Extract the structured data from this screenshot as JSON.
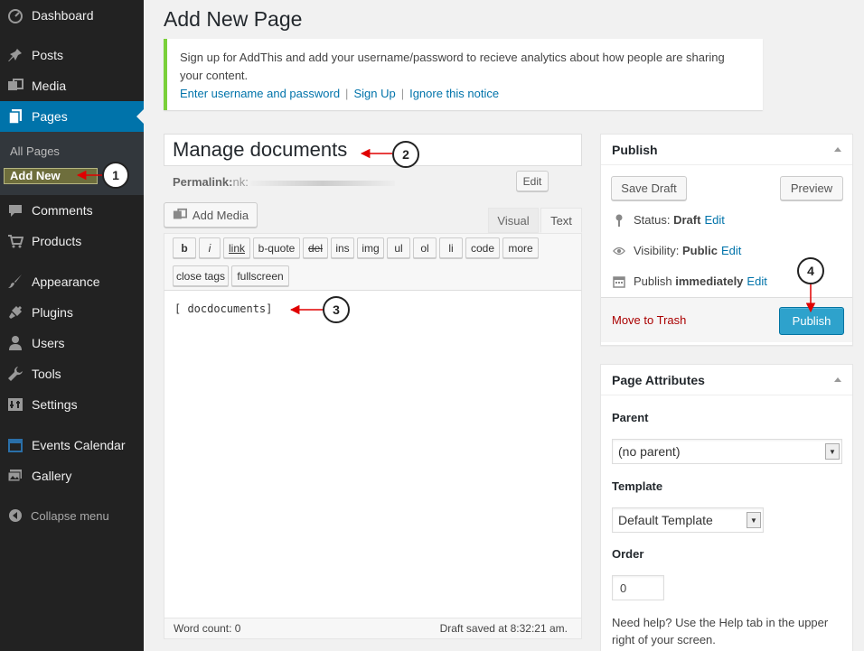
{
  "sidebar": {
    "items": [
      {
        "label": "Dashboard",
        "icon": "dashboard-icon"
      },
      {
        "label": "Posts",
        "icon": "pin-icon"
      },
      {
        "label": "Media",
        "icon": "media-icon"
      },
      {
        "label": "Pages",
        "icon": "pages-icon"
      },
      {
        "label": "Comments",
        "icon": "comment-icon"
      },
      {
        "label": "Products",
        "icon": "cart-icon"
      },
      {
        "label": "Appearance",
        "icon": "brush-icon"
      },
      {
        "label": "Plugins",
        "icon": "plugin-icon"
      },
      {
        "label": "Users",
        "icon": "user-icon"
      },
      {
        "label": "Tools",
        "icon": "wrench-icon"
      },
      {
        "label": "Settings",
        "icon": "settings-icon"
      },
      {
        "label": "Events Calendar",
        "icon": "calendar-icon"
      },
      {
        "label": "Gallery",
        "icon": "gallery-icon"
      }
    ],
    "submenu": {
      "all_pages": "All Pages",
      "add_new": "Add New"
    },
    "collapse": "Collapse menu"
  },
  "page": {
    "title": "Add New Page"
  },
  "notice": {
    "text": "Sign up for AddThis and add your username/password to recieve analytics about how people are sharing your content.",
    "link1": "Enter username and password",
    "link2": "Sign Up",
    "link3": "Ignore this notice",
    "sep": "|"
  },
  "editor": {
    "title_value": "Manage documents",
    "permalink_label": "Permalink:",
    "permalink_value": "nk:",
    "edit_label": "Edit",
    "add_media": "Add Media",
    "tab_visual": "Visual",
    "tab_text": "Text",
    "quicktags_row1": [
      "b",
      "i",
      "link",
      "b-quote",
      "del",
      "ins",
      "img",
      "ul",
      "ol",
      "li",
      "code",
      "more"
    ],
    "quicktags_row2": [
      "close tags",
      "fullscreen"
    ],
    "content": "[    docdocuments]",
    "word_count": "Word count: 0",
    "draft_saved": "Draft saved at 8:32:21 am."
  },
  "publish": {
    "title": "Publish",
    "save_draft": "Save Draft",
    "preview": "Preview",
    "status_label": "Status:",
    "status_value": "Draft",
    "visibility_label": "Visibility:",
    "visibility_value": "Public",
    "publish_label": "Publish",
    "publish_value": "immediately",
    "edit_link": "Edit",
    "move_to_trash": "Move to Trash",
    "publish_button": "Publish"
  },
  "attributes": {
    "title": "Page Attributes",
    "parent_label": "Parent",
    "parent_value": "(no parent)",
    "template_label": "Template",
    "template_value": "Default Template",
    "order_label": "Order",
    "order_value": "0",
    "help": "Need help? Use the Help tab in the upper right of your screen."
  },
  "annotations": [
    "1",
    "2",
    "3",
    "4"
  ],
  "colors": {
    "sidebar_bg": "#222222",
    "active_blue": "#0073aa",
    "publish_blue": "#2ea2cc",
    "notice_green": "#7ad03a",
    "arrow_red": "#e00000",
    "trash_red": "#aa0000"
  }
}
